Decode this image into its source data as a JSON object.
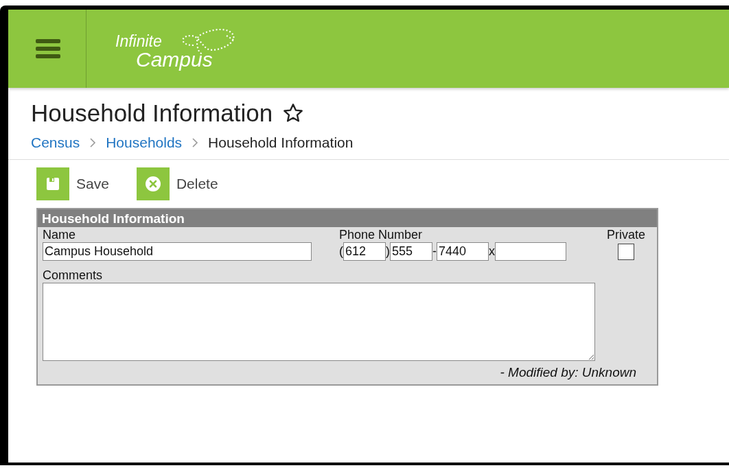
{
  "header": {
    "logo": {
      "line1": "Infinite",
      "line2": "Campus"
    }
  },
  "page": {
    "title": "Household Information",
    "favorite": false
  },
  "breadcrumbs": [
    {
      "label": "Census",
      "link": true
    },
    {
      "label": "Households",
      "link": true
    },
    {
      "label": "Household Information",
      "link": false
    }
  ],
  "toolbar": [
    {
      "kind": "save",
      "label": "Save"
    },
    {
      "kind": "delete",
      "label": "Delete"
    }
  ],
  "panel": {
    "title": "Household Information",
    "name": {
      "label": "Name",
      "value": "Campus Household"
    },
    "phone": {
      "label": "Phone Number",
      "parts": [
        {
          "prefix": "(",
          "value": "612"
        },
        {
          "prefix": ")",
          "value": "555"
        },
        {
          "prefix": "-",
          "value": "7440"
        },
        {
          "prefix": "x"
        }
      ]
    },
    "private": {
      "label": "Private",
      "checked": false
    },
    "comments": {
      "label": "Comments"
    },
    "footer": "- Modified by: Unknown"
  }
}
